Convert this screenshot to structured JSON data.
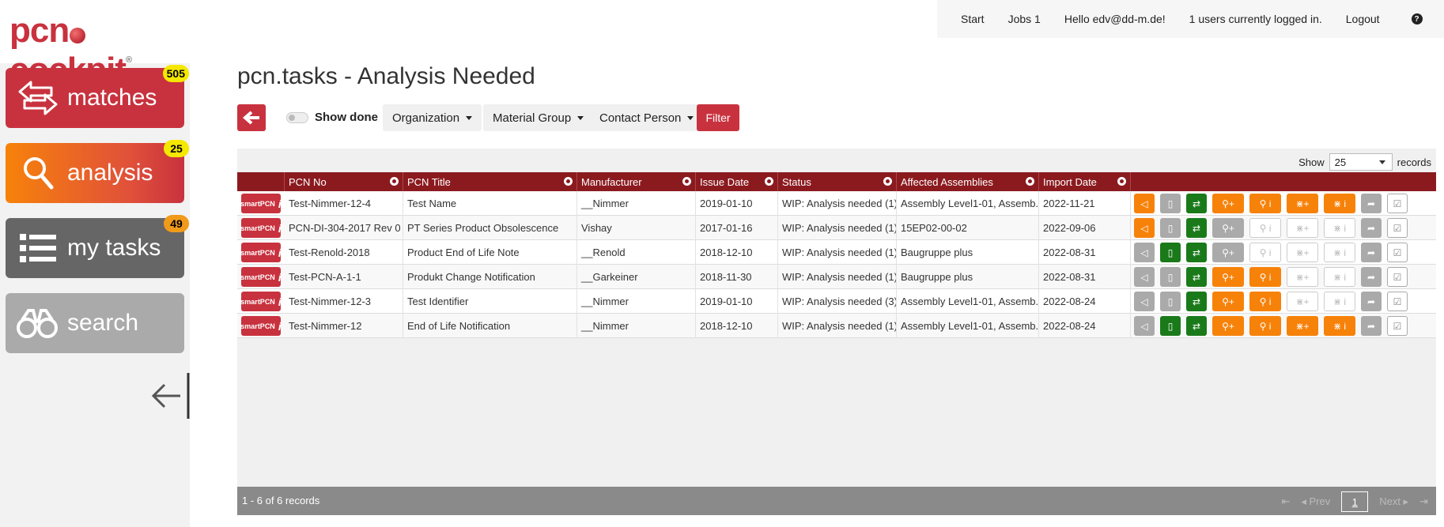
{
  "brand": {
    "logo_pre": "pcn",
    "logo_post": "cockpit",
    "reg": "®"
  },
  "topbar": {
    "start": "Start",
    "jobs": "Jobs 1",
    "hello": "Hello edv@dd-m.de!",
    "users": "1 users currently logged in.",
    "logout": "Logout",
    "help": "?"
  },
  "sidebar": {
    "items": [
      {
        "label": "matches",
        "badge": "505",
        "icon": "swap-arrows-icon"
      },
      {
        "label": "analysis",
        "badge": "25",
        "icon": "magnifier-icon"
      },
      {
        "label": "my tasks",
        "badge": "49",
        "icon": "list-icon"
      },
      {
        "label": "search",
        "icon": "binoculars-icon"
      }
    ]
  },
  "page": {
    "title": "pcn.tasks - Analysis Needed"
  },
  "toolbar": {
    "show_done": "Show done",
    "organization": "Organization",
    "material_group": "Material Group",
    "contact_person": "Contact Person",
    "filter": "Filter"
  },
  "grid": {
    "show_label": "Show",
    "page_size": "25",
    "records_label": "records",
    "columns": [
      "PCN No",
      "PCN Title",
      "Manufacturer",
      "Issue Date",
      "Status",
      "Affected Assemblies",
      "Import Date"
    ],
    "rows": [
      {
        "pcn_no": "Test-Nimmer-12-4",
        "title": "Test Name",
        "manufacturer": "__Nimmer",
        "issue": "2019-01-10",
        "status": "WIP: Analysis needed (1)",
        "assemblies": "Assembly Level1-01, Assemb...",
        "import": "2022-11-21"
      },
      {
        "pcn_no": "PCN-DI-304-2017 Rev 0",
        "title": "PT Series Product Obsolescence",
        "manufacturer": "Vishay",
        "issue": "2017-01-16",
        "status": "WIP: Analysis needed (1)",
        "assemblies": "15EP02-00-02",
        "import": "2022-09-06"
      },
      {
        "pcn_no": "Test-Renold-2018",
        "title": "Product End of Life Note",
        "manufacturer": "__Renold",
        "issue": "2018-12-10",
        "status": "WIP: Analysis needed (1)",
        "assemblies": "Baugruppe plus",
        "import": "2022-08-31"
      },
      {
        "pcn_no": "Test-PCN-A-1-1",
        "title": "Produkt Change Notification",
        "manufacturer": "__Garkeiner",
        "issue": "2018-11-30",
        "status": "WIP: Analysis needed (1)",
        "assemblies": "Baugruppe plus",
        "import": "2022-08-31"
      },
      {
        "pcn_no": "Test-Nimmer-12-3",
        "title": "Test Identifier",
        "manufacturer": "__Nimmer",
        "issue": "2019-01-10",
        "status": "WIP: Analysis needed (3)",
        "assemblies": "Assembly Level1-01, Assemb...",
        "import": "2022-08-24"
      },
      {
        "pcn_no": "Test-Nimmer-12",
        "title": "End of Life Notification",
        "manufacturer": "__Nimmer",
        "issue": "2018-12-10",
        "status": "WIP: Analysis needed (1)",
        "assemblies": "Assembly Level1-01, Assemb...",
        "import": "2022-08-24"
      }
    ],
    "row_button": {
      "text": "smartPCN",
      "info": "i"
    },
    "row_actions": [
      [
        "orange",
        "gray",
        "green",
        "orange",
        "orange",
        "orange",
        "orange",
        "gray",
        "check"
      ],
      [
        "orange",
        "gray",
        "green",
        "gray",
        "ghost",
        "ghost",
        "ghost",
        "gray",
        "check"
      ],
      [
        "gray",
        "green",
        "green",
        "gray",
        "ghost",
        "ghost",
        "ghost",
        "gray",
        "check"
      ],
      [
        "gray",
        "gray",
        "green",
        "orange",
        "orange",
        "ghost",
        "ghost",
        "gray",
        "check"
      ],
      [
        "gray",
        "gray",
        "green",
        "orange",
        "orange",
        "ghost",
        "ghost",
        "gray",
        "check"
      ],
      [
        "gray",
        "green",
        "green",
        "orange",
        "orange",
        "orange",
        "orange",
        "gray",
        "check"
      ]
    ],
    "footer_count": "1 - 6 of 6 records",
    "pager": {
      "first": "⇤",
      "prev": "◂ Prev",
      "current": "1",
      "next": "Next ▸",
      "last": "⇥"
    }
  }
}
